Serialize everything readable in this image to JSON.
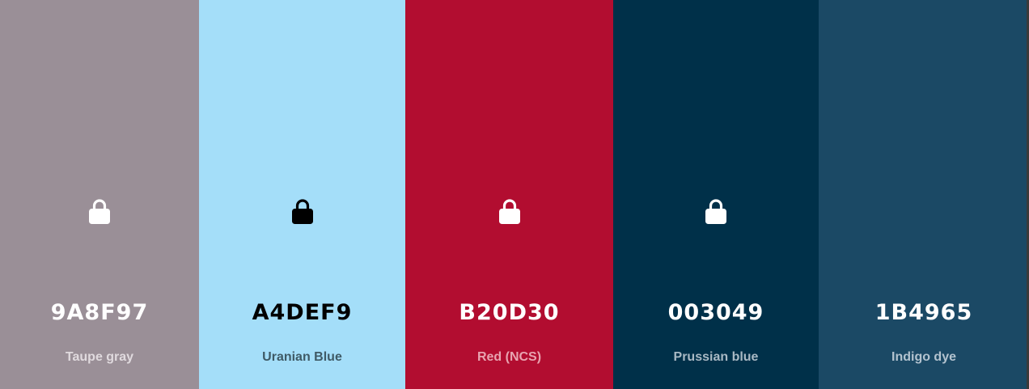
{
  "palette": {
    "colors": [
      {
        "hex": "9A8F97",
        "name": "Taupe gray",
        "bg": "#9A8F97",
        "text": "#FFFFFF",
        "name_color": "#E0DADE",
        "lock": "white",
        "lock_icon": "lock-icon"
      },
      {
        "hex": "A4DEF9",
        "name": "Uranian Blue",
        "bg": "#A4DEF9",
        "text": "#000000",
        "name_color": "#3F5A66",
        "lock": "black",
        "lock_icon": "lock-icon"
      },
      {
        "hex": "B20D30",
        "name": "Red (NCS)",
        "bg": "#B20D30",
        "text": "#FFFFFF",
        "name_color": "#E8A3B0",
        "lock": "white",
        "lock_icon": "lock-icon"
      },
      {
        "hex": "003049",
        "name": "Prussian blue",
        "bg": "#003049",
        "text": "#FFFFFF",
        "name_color": "#A9B9C4",
        "lock": "white",
        "lock_icon": "lock-icon"
      },
      {
        "hex": "1B4965",
        "name": "Indigo dye",
        "bg": "#1B4965",
        "text": "#FFFFFF",
        "name_color": "#B3C3CF",
        "lock": "none"
      }
    ]
  }
}
